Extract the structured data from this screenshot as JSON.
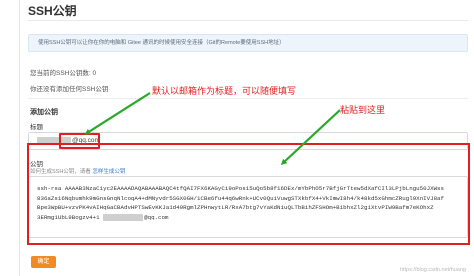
{
  "page": {
    "title": "SSH公钥",
    "info": "使用SSH公钥可以让你在你的电脑和 Gitee 通讯的时候使用安全连接（Git的Remote要使用SSH地址）",
    "key_count": "您当前的SSH公钥数: 0",
    "no_keys": "你还没有添加任何SSH公钥"
  },
  "form": {
    "heading": "添加公钥",
    "title_label": "标题",
    "title_value_suffix": "@qq.com",
    "key_label": "公钥",
    "hint_prefix": "如何生成SSH公钥，请看",
    "hint_link": "怎样生成公钥",
    "key_lines": [
      "ssh-rsa AAAAB3NzaC1yc2EAAAADAQABAAABAQC4tfQAI7FX6KAGyCi9oPos15uQo5b8f16DEx/mYbPhO5r7BfjGrTtew5dXafCIl3LPjbLngu50JXWss",
      "836aZs16Nqbumhk9mGnsGnqNlcoqA4+dMNyvdr5SGX0GH/1CBe6fu44q6wRnk+UCv0QuiVuwgSTXkbfX4+VkImwI8h4/k48kd5xGhmcZRugl9XnIVJ8af",
      "Bpe3WpBU+vzvPK4vAIHqGaCBAdvHPTSwEvKKJa1d49RgmlZPHnwytLR/RxA7btg7vYaKdN1uQLTbBihZFSHOm+BibhxZl2giXtvPIW9Bafm7eKOhxZ",
      "3ERmg1UbL9Bogzv4+1",
      "@qq.com"
    ],
    "confirm_label": "确定"
  },
  "annotations": {
    "email_note": "默认以邮箱作为标题，可以随便填写",
    "paste_note": "粘贴到这里"
  },
  "watermark": "https://blog.csdn.net/huang"
}
